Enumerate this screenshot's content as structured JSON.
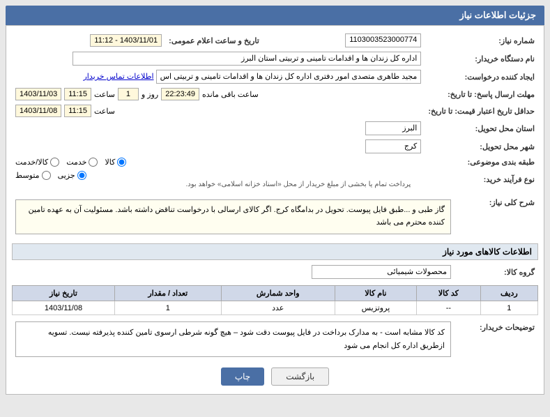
{
  "header": {
    "title": "جزئیات اطلاعات نیاز"
  },
  "fields": {
    "need_number_label": "شماره نیاز:",
    "need_number_value": "1103003523000774",
    "date_time_label": "تاریخ و ساعت اعلام عمومی:",
    "date_time_value": "1403/11/01 - 11:12",
    "buyer_org_label": "نام دستگاه خریدار:",
    "buyer_org_value": "اداره کل زندان ها و اقدامات تامینی و تربیتی استان البرز",
    "creator_label": "ایجاد کننده درخواست:",
    "creator_value": "مجید طاهری متصدی امور دفتری اداره کل زندان ها و اقدامات تامینی و تربیتی اس",
    "creator_link": "اطلاعات تماس خریدار",
    "response_deadline_label": "مهلت ارسال پاسخ: تا تاریخ:",
    "response_date": "1403/11/03",
    "response_time": "11:15",
    "response_day_count": "1",
    "response_remaining": "22:23:49",
    "response_remaining_label": "ساعت باقی مانده",
    "price_deadline_label": "حداقل تاریخ اعتبار قیمت: تا تاریخ:",
    "price_date": "1403/11/08",
    "price_time": "11:15",
    "province_label": "استان محل تحویل:",
    "province_value": "البرز",
    "city_label": "شهر محل تحویل:",
    "city_value": "کرج",
    "category_label": "طبقه بندی موضوعی:",
    "category_options": [
      "کالا",
      "خدمت",
      "کالا/خدمت"
    ],
    "category_selected": "کالا",
    "purchase_type_label": "نوع فرآیند خرید:",
    "purchase_options": [
      "جزیی",
      "متوسط"
    ],
    "purchase_payment_note": "پرداخت تمام یا بخشی از مبلغ خریدار از محل «اسناد خزانه اسلامی» خواهد بود.",
    "description_label": "شرح کلی نیاز:",
    "description_text": "گاز طبی و ...طبق فایل پیوست. تحویل در بدامگاه کرج. اگر کالای ارسالی با درخواست تناقض داشته باشد. مسئولیت آن به عهده تامین کننده محترم می باشد",
    "goods_section_label": "اطلاعات کالاهای مورد نیاز",
    "goods_group_label": "گروه کالا:",
    "goods_group_value": "محصولات شیمیائی",
    "table_headers": {
      "row_num": "ردیف",
      "code": "کد کالا",
      "name": "نام کالا",
      "unit_count": "واحد شمارش",
      "quantity": "تعداد / مقدار",
      "date": "تاریخ نیاز"
    },
    "table_rows": [
      {
        "row_num": "1",
        "code": "--",
        "name": "پروتزیس",
        "unit_count": "عدد",
        "quantity": "1",
        "date": "1403/11/08"
      }
    ],
    "buyer_notes_label": "توضیحات خریدار:",
    "buyer_notes_text": "کد کالا مشابه است - به مدارک برداخت در فایل پیوست دقت شود – هیچ گونه شرطی ارسوی تامین کننده پذیرفته نیست. تسویه ازطریق اداره کل انجام می شود",
    "buttons": {
      "print": "چاپ",
      "back": "بازگشت"
    }
  }
}
